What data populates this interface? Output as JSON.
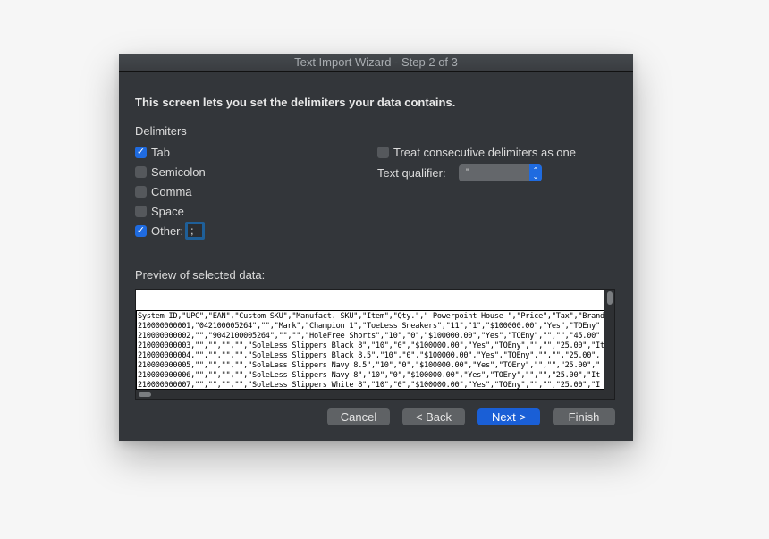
{
  "window": {
    "title": "Text Import Wizard - Step 2 of 3"
  },
  "intro": "This screen lets you set the delimiters your data contains.",
  "delimiters": {
    "label": "Delimiters",
    "items": [
      {
        "label": "Tab",
        "checked": true,
        "mark": "✓"
      },
      {
        "label": "Semicolon",
        "checked": false,
        "mark": ""
      },
      {
        "label": "Comma",
        "checked": false,
        "mark": ""
      },
      {
        "label": "Space",
        "checked": false,
        "mark": ""
      },
      {
        "label": "Other:",
        "checked": true,
        "mark": "✓"
      }
    ],
    "other_value": ";"
  },
  "options": {
    "consecutive_label": "Treat consecutive delimiters as one",
    "consecutive_checked": false,
    "qualifier_label": "Text qualifier:",
    "qualifier_value": "\"",
    "stepper_up": "⌃",
    "stepper_down": "⌄"
  },
  "preview": {
    "label": "Preview of selected data:",
    "rows": [
      "System ID,\"UPC\",\"EAN\",\"Custom SKU\",\"Manufact. SKU\",\"Item\",\"Qty.\",\" Powerpoint House \",\"Price\",\"Tax\",\"Brand\"",
      "210000000001,\"042100005264\",\"\",\"Mark\",\"Champion 1\",\"ToeLess Sneakers\",\"11\",\"1\",\"$100000.00\",\"Yes\",\"TOEny\"",
      "210000000002,\"\",\"9042100005264\",\"\",\"\",\"HoleFree Shorts\",\"10\",\"0\",\"$100000.00\",\"Yes\",\"TOEny\",\"\",\"\",\"45.00\"",
      "210000000003,\"\",\"\",\"\",\"\",\"SoleLess Slippers Black 8\",\"10\",\"0\",\"$100000.00\",\"Yes\",\"TOEny\",\"\",\"\",\"25.00\",\"It",
      "210000000004,\"\",\"\",\"\",\"\",\"SoleLess Slippers Black 8.5\",\"10\",\"0\",\"$100000.00\",\"Yes\",\"TOEny\",\"\",\"\",\"25.00\",",
      "210000000005,\"\",\"\",\"\",\"\",\"SoleLess Slippers Navy 8.5\",\"10\",\"0\",\"$100000.00\",\"Yes\",\"TOEny\",\"\",\"\",\"25.00\",\"",
      "210000000006,\"\",\"\",\"\",\"\",\"SoleLess Slippers Navy 8\",\"10\",\"0\",\"$100000.00\",\"Yes\",\"TOEny\",\"\",\"\",\"25.00\",\"It",
      "210000000007,\"\",\"\",\"\",\"\",\"SoleLess Slippers White 8\",\"10\",\"0\",\"$100000.00\",\"Yes\",\"TOEny\",\"\",\"\",\"25.00\",\"I"
    ]
  },
  "buttons": {
    "cancel": "Cancel",
    "back": "< Back",
    "next": "Next >",
    "finish": "Finish"
  },
  "colors": {
    "accent": "#1f6be0",
    "window_bg": "#33363a"
  }
}
